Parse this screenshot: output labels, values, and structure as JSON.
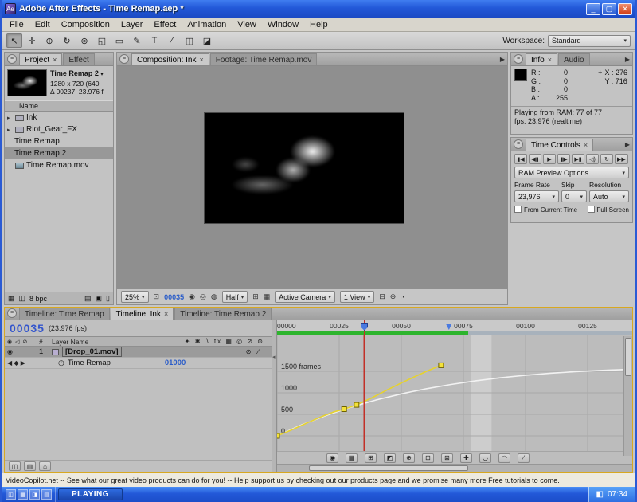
{
  "glyphs": {
    "close": "×",
    "dropdown": "▾",
    "flyout": "▶",
    "expander": "▸",
    "crosshair": "+",
    "collapse": "◂",
    "minimize": "_",
    "maximize": "▢",
    "close_win": "✕",
    "eye": "◉",
    "av_icons": "◉ ◁ ⊘",
    "keyframe_nav": "◀ ◆ ▶",
    "stopwatch": "◷",
    "tray": "◧",
    "panel_menu": "≡"
  },
  "window": {
    "title": "Adobe After Effects - Time Remap.aep *"
  },
  "menu": {
    "items": [
      "File",
      "Edit",
      "Composition",
      "Layer",
      "Effect",
      "Animation",
      "View",
      "Window",
      "Help"
    ]
  },
  "toolbar": {
    "workspace_label": "Workspace:",
    "workspace_value": "Standard",
    "tools": [
      {
        "name": "selection-tool",
        "glyph": "↖",
        "active": true
      },
      {
        "name": "hand-tool",
        "glyph": "✛"
      },
      {
        "name": "zoom-tool",
        "glyph": "⊕"
      },
      {
        "name": "rotation-tool",
        "glyph": "↻"
      },
      {
        "name": "orbit-camera-tool",
        "glyph": "⊚"
      },
      {
        "name": "pan-behind-tool",
        "glyph": "◱"
      },
      {
        "name": "mask-shape-tool",
        "glyph": "▭"
      },
      {
        "name": "pen-tool",
        "glyph": "✎"
      },
      {
        "name": "type-tool",
        "glyph": "T"
      },
      {
        "name": "brush-tool",
        "glyph": "∕"
      },
      {
        "name": "clone-stamp-tool",
        "glyph": "◫"
      },
      {
        "name": "eraser-tool",
        "glyph": "◪"
      }
    ]
  },
  "project": {
    "tabs": {
      "project": "Project",
      "effect": "Effect"
    },
    "preview": {
      "name": "Time Remap 2",
      "line1": "1280 x 720 (640",
      "line2": "Δ 00237, 23.976 f"
    },
    "name_header": "Name",
    "items": [
      {
        "label": "Ink",
        "type": "folder"
      },
      {
        "label": "Riot_Gear_FX",
        "type": "folder"
      },
      {
        "label": "Time Remap",
        "type": "comp"
      },
      {
        "label": "Time Remap 2",
        "type": "comp",
        "selected": true
      },
      {
        "label": "Time Remap.mov",
        "type": "footage"
      }
    ],
    "footer_bpc": "8 bpc",
    "icons": {
      "list_view": "▦",
      "icon_view": "◫",
      "new_folder": "▤",
      "new_comp": "▣",
      "trash": "▯"
    }
  },
  "viewer": {
    "tabs": {
      "composition": "Composition: Ink",
      "footage": "Footage: Time Remap.mov"
    },
    "zoom": "25%",
    "frame": "00035",
    "resolution": "Half",
    "camera": "Active Camera",
    "view_layout": "1 View",
    "icons": {
      "safe_margins": "⊡",
      "snapshot": "◉",
      "show_snapshot": "◎",
      "channels": "◍",
      "roi": "⊞",
      "transparency": "▦",
      "timecode": "⊟",
      "aspect": "⊕",
      "exposure": "◔"
    }
  },
  "info": {
    "tabs": {
      "info": "Info",
      "audio": "Audio"
    },
    "channels": [
      {
        "label": "R :",
        "value": "0"
      },
      {
        "label": "G :",
        "value": "0"
      },
      {
        "label": "B :",
        "value": "0"
      },
      {
        "label": "A :",
        "value": "255"
      }
    ],
    "x_label": "X :",
    "x_value": "276",
    "y_label": "Y :",
    "y_value": "716",
    "status_line1": "Playing from RAM: 77 of 77",
    "status_line2": "fps: 23.976 (realtime)"
  },
  "time_controls": {
    "title": "Time Controls",
    "transport": [
      {
        "name": "first-frame-button",
        "glyph": "▮◀"
      },
      {
        "name": "previous-frame-button",
        "glyph": "◀▮"
      },
      {
        "name": "play-button",
        "glyph": "▶"
      },
      {
        "name": "next-frame-button",
        "glyph": "▮▶"
      },
      {
        "name": "last-frame-button",
        "glyph": "▶▮"
      },
      {
        "name": "audio-toggle-button",
        "glyph": "◁)"
      },
      {
        "name": "loop-button",
        "glyph": "↻"
      },
      {
        "name": "ram-preview-button",
        "glyph": "▶▶"
      }
    ],
    "ram_preview_options": "RAM Preview Options",
    "frame_rate_label": "Frame Rate",
    "frame_rate_value": "23,976",
    "skip_label": "Skip",
    "skip_value": "0",
    "resolution_label": "Resolution",
    "resolution_value": "Auto",
    "from_current_time_label": "From Current Time",
    "full_screen_label": "Full Screen"
  },
  "timeline": {
    "tabs": [
      {
        "label": "Timeline: Time Remap"
      },
      {
        "label": "Timeline: Ink",
        "active": true
      },
      {
        "label": "Timeline: Time Remap 2"
      }
    ],
    "current_time": "00035",
    "fps_note": "(23.976 fps)",
    "header": {
      "number": "#",
      "layer_name": "Layer Name",
      "switches": "✦ ✱ ∖ fx ▦ ◎ ⊘ ⊛"
    },
    "layer": {
      "number": "1",
      "name": "[Drop_01.mov]",
      "switches": "⊘ ∕"
    },
    "property": {
      "name": "Time Remap",
      "value": "01000"
    },
    "graph": {
      "ruler": [
        {
          "f": 0,
          "label": "00000"
        },
        {
          "f": 25,
          "label": "00025"
        },
        {
          "f": 50,
          "label": "00050"
        },
        {
          "f": 75,
          "label": "00075"
        },
        {
          "f": 100,
          "label": "00100"
        },
        {
          "f": 125,
          "label": "00125"
        }
      ],
      "y_ticks": [
        {
          "v": 1500,
          "label": "1500 frames"
        },
        {
          "v": 1000,
          "label": "1000"
        },
        {
          "v": 500,
          "label": "500"
        },
        {
          "v": 0,
          "label": "0"
        }
      ],
      "white_curve": [
        [
          0,
          0
        ],
        [
          10,
          260
        ],
        [
          20,
          480
        ],
        [
          30,
          670
        ],
        [
          40,
          835
        ],
        [
          50,
          975
        ],
        [
          60,
          1095
        ],
        [
          70,
          1195
        ],
        [
          80,
          1280
        ],
        [
          90,
          1350
        ],
        [
          100,
          1408
        ],
        [
          110,
          1455
        ],
        [
          120,
          1492
        ],
        [
          130,
          1520
        ],
        [
          142,
          1545
        ]
      ],
      "selected_curve": [
        [
          0,
          0
        ],
        [
          6,
          140
        ],
        [
          12,
          300
        ],
        [
          18,
          450
        ],
        [
          23,
          560
        ],
        [
          27,
          620
        ],
        [
          32,
          720
        ],
        [
          38,
          880
        ],
        [
          44,
          1060
        ],
        [
          50,
          1230
        ],
        [
          56,
          1390
        ],
        [
          61,
          1520
        ],
        [
          66,
          1640
        ]
      ],
      "keyframes": [
        [
          0,
          0
        ],
        [
          27,
          620
        ],
        [
          32,
          720
        ],
        [
          66,
          1640
        ]
      ],
      "current_frame": 35,
      "marker_frame": 69,
      "cached_frames": 77
    },
    "graph_tools": [
      {
        "name": "show-properties-button",
        "glyph": "◉"
      },
      {
        "name": "graph-type-button",
        "glyph": "▦"
      },
      {
        "name": "show-transform-box-button",
        "glyph": "⊞"
      },
      {
        "name": "snap-button",
        "glyph": "◩"
      },
      {
        "name": "auto-zoom-button",
        "glyph": "⊕"
      },
      {
        "name": "fit-selection-button",
        "glyph": "⊡"
      },
      {
        "name": "fit-all-button",
        "glyph": "⊠"
      },
      {
        "name": "edit-keyframes-button",
        "glyph": "✚"
      },
      {
        "name": "easy-ease-button",
        "glyph": "◡"
      },
      {
        "name": "easy-ease-in-button",
        "glyph": "◠"
      },
      {
        "name": "easy-ease-out-button",
        "glyph": "∕"
      }
    ],
    "left_tools": [
      {
        "name": "expand-layer-switches-button",
        "glyph": "◫"
      },
      {
        "name": "expand-transfer-controls-button",
        "glyph": "▥"
      },
      {
        "name": "expand-inout-button",
        "glyph": "⌂"
      }
    ]
  },
  "status_bar": {
    "text": "VideoCopilot.net -- See what our great video products can do for you! -- Help support us by checking out our products page and we promise many more Free tutorials to come."
  },
  "taskbar": {
    "quick_launch": [
      {
        "name": "quick-launch-1",
        "glyph": "◫"
      },
      {
        "name": "quick-launch-2",
        "glyph": "▦"
      },
      {
        "name": "quick-launch-3",
        "glyph": "◨"
      },
      {
        "name": "quick-launch-4",
        "glyph": "▤"
      }
    ],
    "task_button": "PLAYING",
    "clock": "07:34"
  }
}
